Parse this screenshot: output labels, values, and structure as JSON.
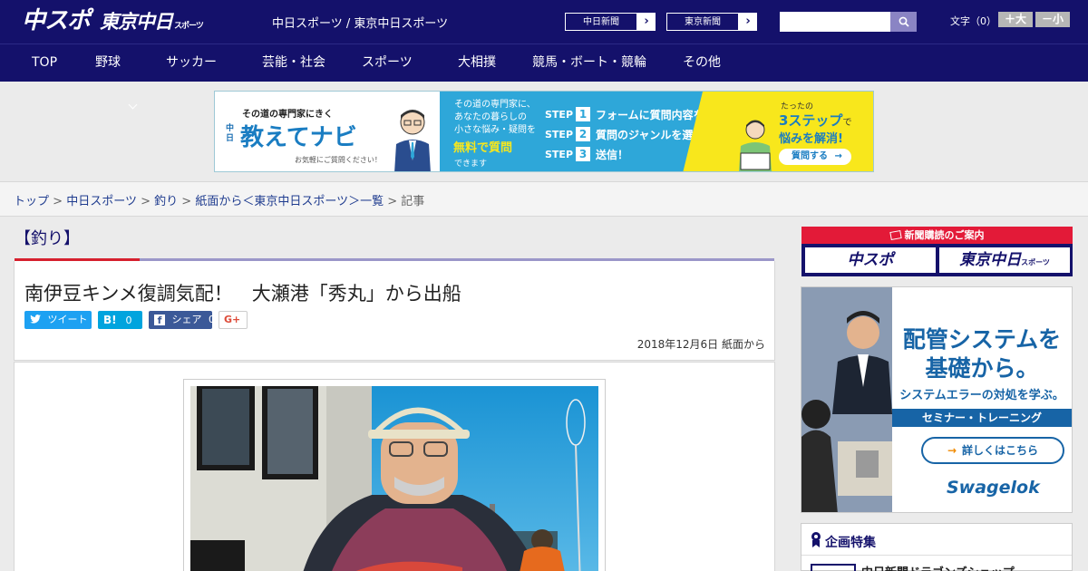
{
  "header": {
    "logo_chuspo": "中スポ",
    "logo_tokyo": "東京中日",
    "logo_tokyo_small": "スポーツ",
    "site_name": "中日スポーツ / 東京中日スポーツ",
    "paper_links": [
      "中日新聞",
      "東京新聞"
    ],
    "search": {
      "placeholder": ""
    },
    "font_size_label": "文字（0）",
    "font_bigger": "＋大",
    "font_smaller": "－小"
  },
  "nav": {
    "items": [
      {
        "label": "TOP",
        "has_menu": false
      },
      {
        "label": "野球",
        "has_menu": true
      },
      {
        "label": "サッカー",
        "has_menu": true
      },
      {
        "label": "芸能・社会",
        "has_menu": false
      },
      {
        "label": "スポーツ",
        "has_menu": true
      },
      {
        "label": "大相撲",
        "has_menu": false
      },
      {
        "label": "競馬・ボート・競輪",
        "has_menu": false
      },
      {
        "label": "その他",
        "has_menu": true
      }
    ]
  },
  "banner": {
    "tagline": "その道の専門家にきく",
    "brand_prefix": "中日",
    "brand": "教えてナビ",
    "left_note": "お気軽にご質問ください！",
    "mid_lines": [
      "その道の専門家に、",
      "あなたの暮らしの",
      "小さな悩み・疑問を"
    ],
    "free": "無料で質問",
    "dekimasu": "できます",
    "steps": [
      {
        "label": "STEP",
        "num": "1",
        "text": "フォームに質問内容を入力"
      },
      {
        "label": "STEP",
        "num": "2",
        "text": "質問のジャンルを選択"
      },
      {
        "label": "STEP",
        "num": "3",
        "text": "送信！"
      }
    ],
    "right_small": "たったの",
    "right_big": "3ステップ",
    "right_de": "で",
    "right_solve": "悩みを解消!",
    "cta": "質問する"
  },
  "breadcrumb": {
    "links": [
      "トップ",
      "中日スポーツ",
      "釣り",
      "紙面から＜東京中日スポーツ＞一覧"
    ],
    "separator": ">",
    "current": "記事"
  },
  "article": {
    "category": "【釣り】",
    "title": "南伊豆キンメ復調気配！　大瀬港「秀丸」から出船",
    "share": {
      "tweet": "ツイート",
      "hatena_icon": "B!",
      "hatena_count": "0",
      "facebook_share": "シェア",
      "facebook_count": "0",
      "gplus": "G+"
    },
    "date": "2018年12月6日 紙面から"
  },
  "sidebar": {
    "subscription_header": "新聞購読のご案内",
    "sub_chuspo": "中スポ",
    "sub_tokyo": "東京中日",
    "sub_tokyo_small": "スポーツ",
    "ad": {
      "headline_1": "配管システムを",
      "headline_2": "基礎から。",
      "sub": "システムエラーの対処を学ぶ。",
      "band": "セミナー・トレーニング",
      "button": "詳しくはこちら",
      "brand": "Swagelok"
    },
    "kikaku_title": "企画特集",
    "kikaku_item": "中日新聞ドラゴンズショップ"
  },
  "colors": {
    "brand_navy": "#14116b",
    "accent_red": "#d6202e",
    "link_blue": "#1f3c8f",
    "twitter": "#1da1f2",
    "hatena": "#00a4de",
    "facebook": "#3b5998"
  }
}
